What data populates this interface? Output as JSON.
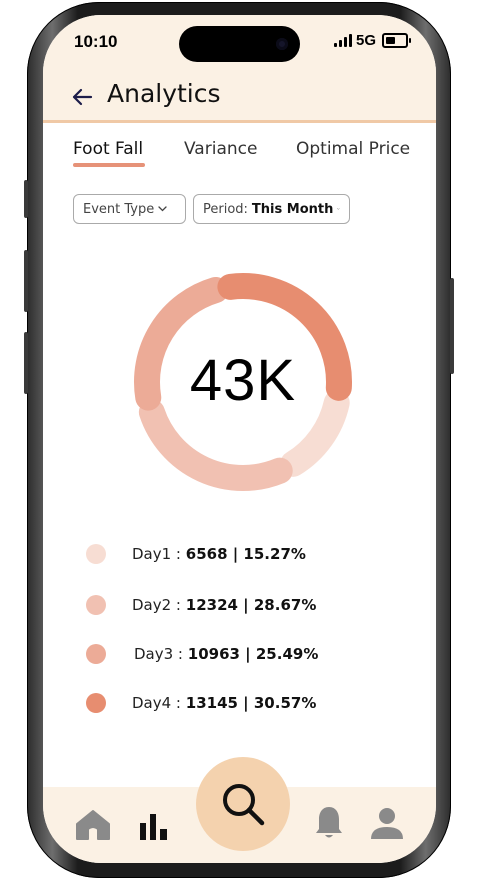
{
  "status_bar": {
    "time": "10:10",
    "network": "5G"
  },
  "header": {
    "title": "Analytics"
  },
  "tabs": [
    {
      "label": "Foot Fall",
      "active": true
    },
    {
      "label": "Variance",
      "active": false
    },
    {
      "label": "Optimal Price",
      "active": false
    }
  ],
  "filters": {
    "event_type": {
      "label": "Event Type"
    },
    "period": {
      "prefix": "Period:",
      "value": "This Month"
    }
  },
  "summary": {
    "total": "43K"
  },
  "chart_data": {
    "type": "pie",
    "categories": [
      "Day1",
      "Day2",
      "Day3",
      "Day4"
    ],
    "values": [
      6568,
      12324,
      10963,
      13145
    ],
    "percents": [
      15.27,
      28.67,
      25.49,
      30.57
    ],
    "colors": [
      "#f7ddd3",
      "#f1c1b2",
      "#ecab97",
      "#e78d70"
    ]
  },
  "legend": [
    {
      "label": "Day1 :",
      "value_text": "6568 | 15.27%"
    },
    {
      "label": "Day2 :",
      "value_text": "12324 | 28.67%"
    },
    {
      "label": "Day3 :",
      "value_text": "10963 | 25.49%"
    },
    {
      "label": "Day4 :",
      "value_text": "13145 | 30.57%"
    }
  ],
  "bottom_nav": {
    "items": [
      "home-icon",
      "bar-chart-icon",
      "search-icon",
      "bell-icon",
      "user-icon"
    ],
    "active": "bar-chart-icon",
    "accent": "#f4d2ae",
    "icon_color": "#8a8a8a"
  }
}
